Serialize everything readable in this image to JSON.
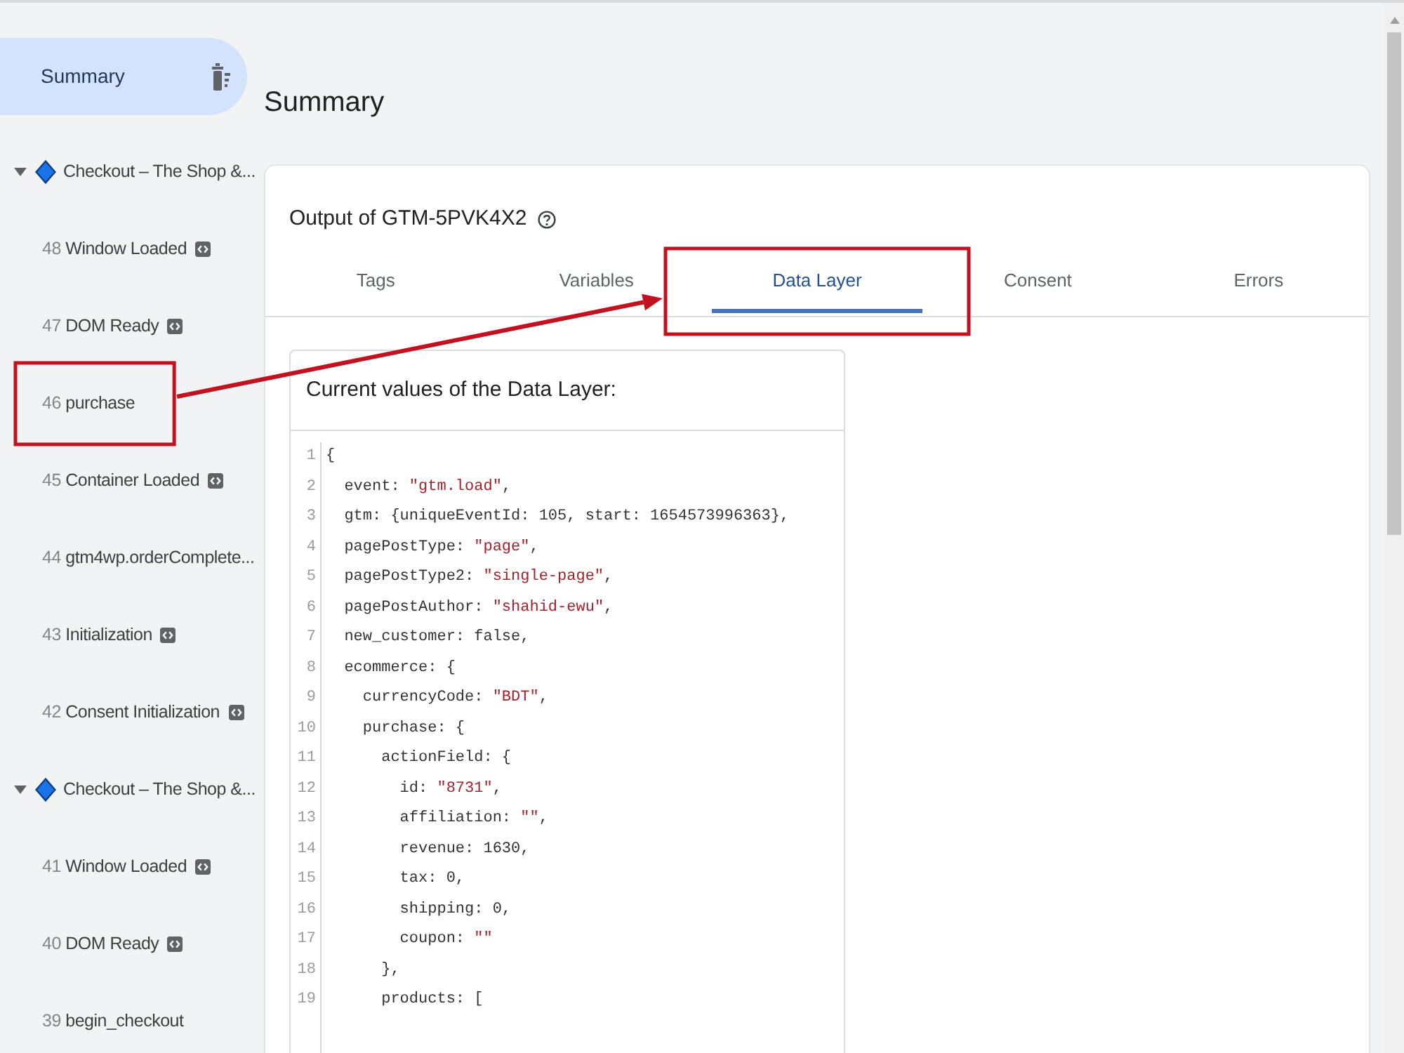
{
  "sidebar": {
    "summary": {
      "label": "Summary",
      "selected": true
    },
    "groups": [
      {
        "label": "Checkout – The Shop &...",
        "expanded": true,
        "selected": false,
        "children": [
          {
            "number": "48",
            "label": "Window Loaded",
            "code_icon": true,
            "selected": false,
            "highlighted": false
          },
          {
            "number": "47",
            "label": "DOM Ready",
            "code_icon": true,
            "selected": false,
            "highlighted": false
          },
          {
            "number": "46",
            "label": "purchase",
            "code_icon": false,
            "selected": false,
            "highlighted": true
          },
          {
            "number": "45",
            "label": "Container Loaded",
            "code_icon": true,
            "selected": false,
            "highlighted": false
          },
          {
            "number": "44",
            "label": "gtm4wp.orderComplete...",
            "code_icon": false,
            "selected": false,
            "highlighted": false
          },
          {
            "number": "43",
            "label": "Initialization",
            "code_icon": true,
            "selected": false,
            "highlighted": false
          },
          {
            "number": "42",
            "label": "Consent Initialization",
            "code_icon": true,
            "selected": false,
            "highlighted": false
          }
        ]
      },
      {
        "label": "Checkout – The Shop &...",
        "expanded": true,
        "selected": false,
        "children": [
          {
            "number": "41",
            "label": "Window Loaded",
            "code_icon": true,
            "selected": false,
            "highlighted": false
          },
          {
            "number": "40",
            "label": "DOM Ready",
            "code_icon": true,
            "selected": false,
            "highlighted": false
          },
          {
            "number": "39",
            "label": "begin_checkout",
            "code_icon": false,
            "selected": false,
            "highlighted": false
          }
        ]
      }
    ]
  },
  "page_title": "Summary",
  "output_card": {
    "title": "Output of GTM-5PVK4X2",
    "tabs": [
      {
        "label": "Tags",
        "selected": false,
        "highlighted": false
      },
      {
        "label": "Variables",
        "selected": false,
        "highlighted": false
      },
      {
        "label": "Data Layer",
        "selected": true,
        "highlighted": true
      },
      {
        "label": "Consent",
        "selected": false,
        "highlighted": false
      },
      {
        "label": "Errors",
        "selected": false,
        "highlighted": false
      }
    ],
    "data_layer": {
      "title": "Current values of the Data Layer:",
      "lines": [
        {
          "number": "1",
          "code": "{"
        },
        {
          "number": "2",
          "code": "  event: \"gtm.load\","
        },
        {
          "number": "3",
          "code": "  gtm: {uniqueEventId: 105, start: 1654573996363},"
        },
        {
          "number": "4",
          "code": "  pagePostType: \"page\","
        },
        {
          "number": "5",
          "code": "  pagePostType2: \"single-page\","
        },
        {
          "number": "6",
          "code": "  pagePostAuthor: \"shahid-ewu\","
        },
        {
          "number": "7",
          "code": "  new_customer: false,"
        },
        {
          "number": "8",
          "code": "  ecommerce: {"
        },
        {
          "number": "9",
          "code": "    currencyCode: \"BDT\","
        },
        {
          "number": "10",
          "code": "    purchase: {"
        },
        {
          "number": "11",
          "code": "      actionField: {"
        },
        {
          "number": "12",
          "code": "        id: \"8731\","
        },
        {
          "number": "13",
          "code": "        affiliation: \"\","
        },
        {
          "number": "14",
          "code": "        revenue: 1630,"
        },
        {
          "number": "15",
          "code": "        tax: 0,"
        },
        {
          "number": "16",
          "code": "        shipping: 0,"
        },
        {
          "number": "17",
          "code": "        coupon: \"\""
        },
        {
          "number": "18",
          "code": "      },"
        },
        {
          "number": "19",
          "code": "      products: ["
        }
      ]
    }
  }
}
